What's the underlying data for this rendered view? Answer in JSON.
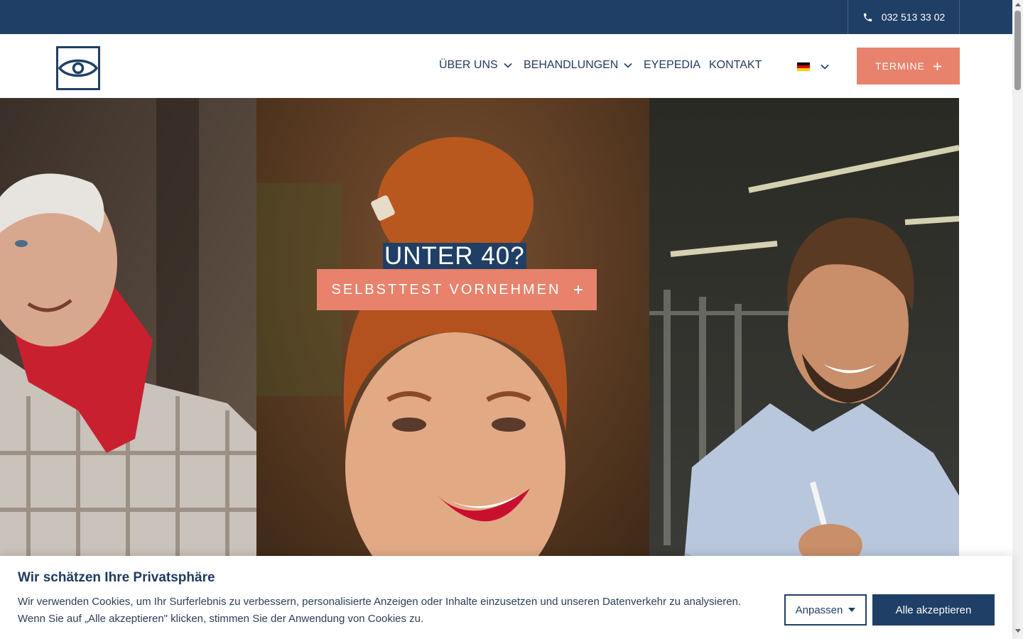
{
  "topbar": {
    "phone": "032 513 33 02"
  },
  "nav": {
    "items": [
      {
        "label": "ÜBER UNS",
        "has_dropdown": true
      },
      {
        "label": "BEHANDLUNGEN",
        "has_dropdown": true
      },
      {
        "label": "EYEPEDIA",
        "has_dropdown": false
      },
      {
        "label": "KONTAKT",
        "has_dropdown": false
      }
    ],
    "language": "de",
    "cta_label": "TERMINE",
    "cta_icon": "plus-icon"
  },
  "hero": {
    "title": "UNTER 40?",
    "cta_label": "SELBSTTEST VORNEHMEN",
    "cta_icon": "plus-icon"
  },
  "cookie": {
    "title": "Wir schätzen Ihre Privatsphäre",
    "text_line1": "Wir verwenden Cookies, um Ihr Surferlebnis zu verbessern, personalisierte Anzeigen oder Inhalte einzusetzen und unseren Datenverkehr zu analysieren.",
    "text_line2": "Wenn Sie auf „Alle akzeptieren\" klicken, stimmen Sie der Anwendung von Cookies zu.",
    "customize_label": "Anpassen",
    "accept_label": "Alle akzeptieren"
  },
  "colors": {
    "navy": "#203f66",
    "accent": "#e8826c",
    "text": "#1f3a5f"
  }
}
